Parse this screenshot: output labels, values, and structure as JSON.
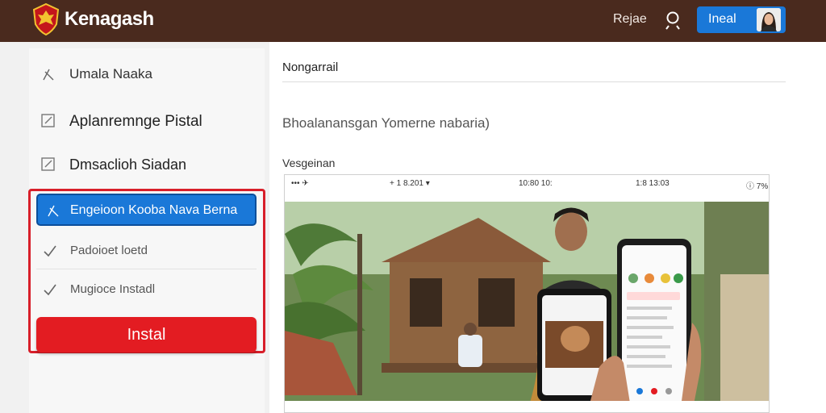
{
  "header": {
    "brand": "Kenagash",
    "nav_link": "Rejae",
    "login_label": "Ineal"
  },
  "sidebar": {
    "items": [
      {
        "label": "Umala Naaka",
        "icon": "x-icon"
      },
      {
        "label": "Aplanremnge Pistal",
        "icon": "checkbox-icon"
      },
      {
        "label": "Dmsaclioh Siadan",
        "icon": "checkbox-icon"
      }
    ],
    "active_item": {
      "label": "Engeioon Kooba Nava Berna",
      "icon": "x-icon"
    },
    "sub_items": [
      {
        "label": "Padoioet loetd",
        "icon": "check-icon"
      },
      {
        "label": "Mugioce Instadl",
        "icon": "check-icon"
      }
    ],
    "install_label": "Instal"
  },
  "main": {
    "title": "Nongarrail",
    "subtitle": "Bhoalanansgan Yomerne nabaria)",
    "section_label": "Vesgeinan",
    "status_bar": [
      "••• ✈",
      "+ 1 8.201 ▾",
      "10:80 10:",
      "1:8 13:03",
      "ⓘ 7% ▮"
    ]
  },
  "colors": {
    "header_bg": "#4a2a1e",
    "accent_blue": "#1a78d8",
    "accent_red": "#e31c22"
  }
}
